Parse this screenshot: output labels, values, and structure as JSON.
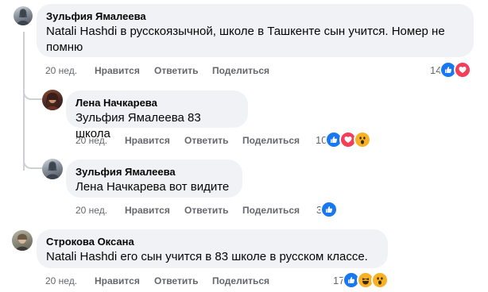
{
  "comments": [
    {
      "author": "Зульфия Ямалеева",
      "text": "Natali Hashdi в русскоязычной, школе в Ташкенте сын учится. Номер не помню",
      "time": "20 нед.",
      "like": "Нравится",
      "reply": "Ответить",
      "share": "Поделиться",
      "reactions_count": "14",
      "reactions": [
        "like-icon",
        "love-icon"
      ]
    },
    {
      "author": "Лена Начкарева",
      "text": "Зульфия Ямалеева 83 школа",
      "time": "20 нед.",
      "like": "Нравится",
      "reply": "Ответить",
      "share": "Поделиться",
      "reactions_count": "10",
      "reactions": [
        "like-icon",
        "love-icon",
        "wow-icon"
      ]
    },
    {
      "author": "Зульфия Ямалеева",
      "text": "Лена Начкарева вот видите",
      "time": "20 нед.",
      "like": "Нравится",
      "reply": "Ответить",
      "share": "Поделиться",
      "reactions_count": "3",
      "reactions": [
        "like-icon"
      ]
    },
    {
      "author": "Строкова Оксана",
      "text": "Natali Hashdi его сын учится в 83 школе в русском классе.",
      "time": "20 нед.",
      "like": "Нравится",
      "reply": "Ответить",
      "share": "Поделиться",
      "reactions_count": "17",
      "reactions": [
        "like-icon",
        "haha-icon",
        "wow-icon"
      ]
    }
  ],
  "colors": {
    "bubble": "#f0f2f5",
    "like": "#1877f2",
    "love": "#f33e58",
    "emoji": "#f7b125",
    "meta": "#65676b"
  }
}
